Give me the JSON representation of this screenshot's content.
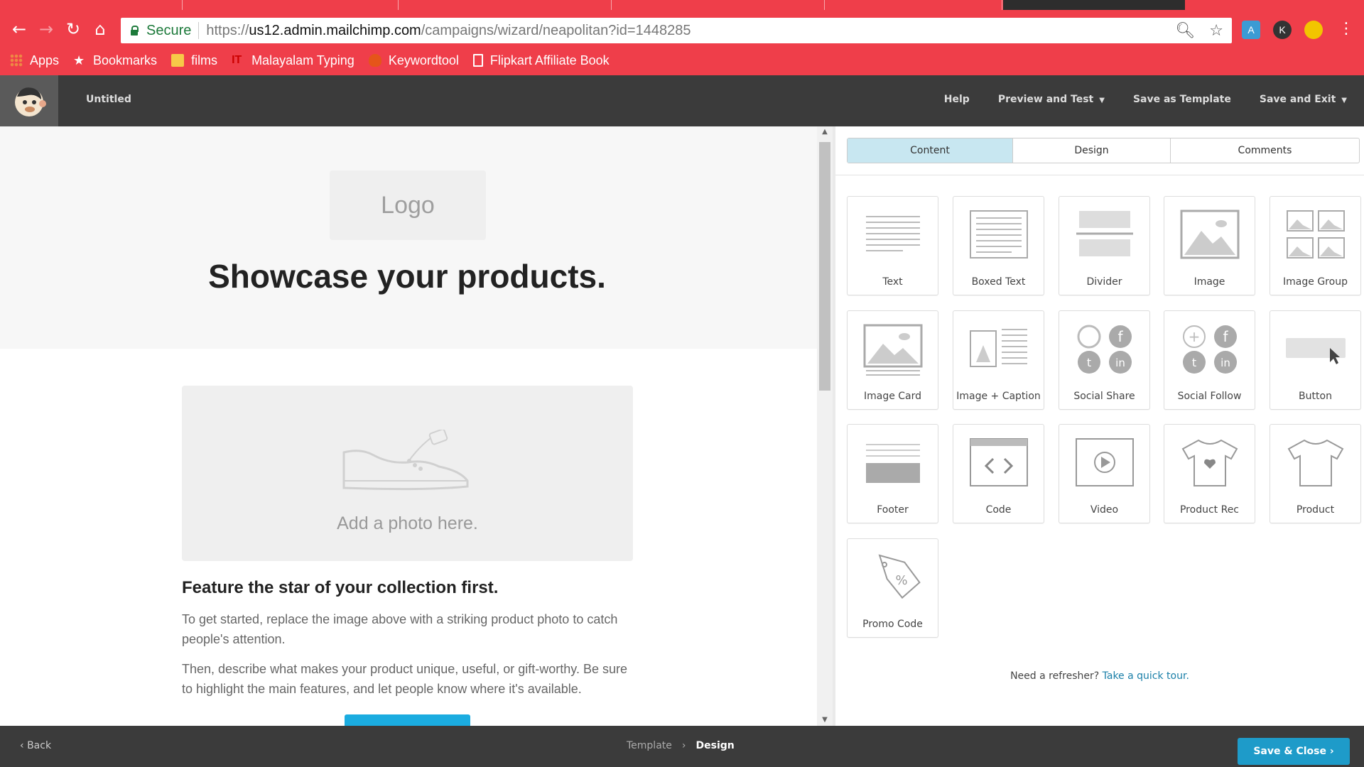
{
  "browser": {
    "secure_label": "Secure",
    "url_scheme": "https://",
    "url_host": "us12.admin.mailchimp.com",
    "url_path": "/campaigns/wizard/neapolitan?id=1448285",
    "bookmarks": [
      "Apps",
      "Bookmarks",
      "films",
      "Malayalam Typing",
      "Keywordtool",
      "Flipkart Affiliate Book"
    ],
    "profile_initial": "K",
    "chrome_color": "#ef3e4a"
  },
  "app": {
    "campaign_title": "Untitled",
    "nav": {
      "help": "Help",
      "preview": "Preview and Test",
      "save_template": "Save as Template",
      "save_exit": "Save and Exit"
    }
  },
  "canvas": {
    "logo_placeholder": "Logo",
    "hero_title": "Showcase your products.",
    "photo_placeholder": "Add a photo here.",
    "feature_title": "Feature the star of your collection first.",
    "paragraph1": "To get started, replace the image above with a striking product photo to catch people's attention.",
    "paragraph2": "Then, describe what makes your product unique, useful, or gift-worthy. Be sure to highlight the main features, and let people know where it's available."
  },
  "panel": {
    "tabs": [
      "Content",
      "Design",
      "Comments"
    ],
    "active_tab": "Content",
    "blocks": [
      {
        "label": "Text",
        "icon": "text-icon"
      },
      {
        "label": "Boxed Text",
        "icon": "boxed-text-icon"
      },
      {
        "label": "Divider",
        "icon": "divider-icon"
      },
      {
        "label": "Image",
        "icon": "image-icon"
      },
      {
        "label": "Image Group",
        "icon": "image-group-icon"
      },
      {
        "label": "Image Card",
        "icon": "image-card-icon"
      },
      {
        "label": "Image + Caption",
        "icon": "image-caption-icon"
      },
      {
        "label": "Social Share",
        "icon": "social-share-icon"
      },
      {
        "label": "Social Follow",
        "icon": "social-follow-icon"
      },
      {
        "label": "Button",
        "icon": "button-icon"
      },
      {
        "label": "Footer",
        "icon": "footer-icon"
      },
      {
        "label": "Code",
        "icon": "code-icon"
      },
      {
        "label": "Video",
        "icon": "video-icon"
      },
      {
        "label": "Product Rec",
        "icon": "product-rec-icon"
      },
      {
        "label": "Product",
        "icon": "product-icon"
      },
      {
        "label": "Promo Code",
        "icon": "promo-code-icon"
      }
    ],
    "refresher_text": "Need a refresher?",
    "refresher_link": "Take a quick tour."
  },
  "bottom": {
    "back": "Back",
    "crumb1": "Template",
    "crumb2": "Design",
    "save_close": "Save & Close"
  }
}
